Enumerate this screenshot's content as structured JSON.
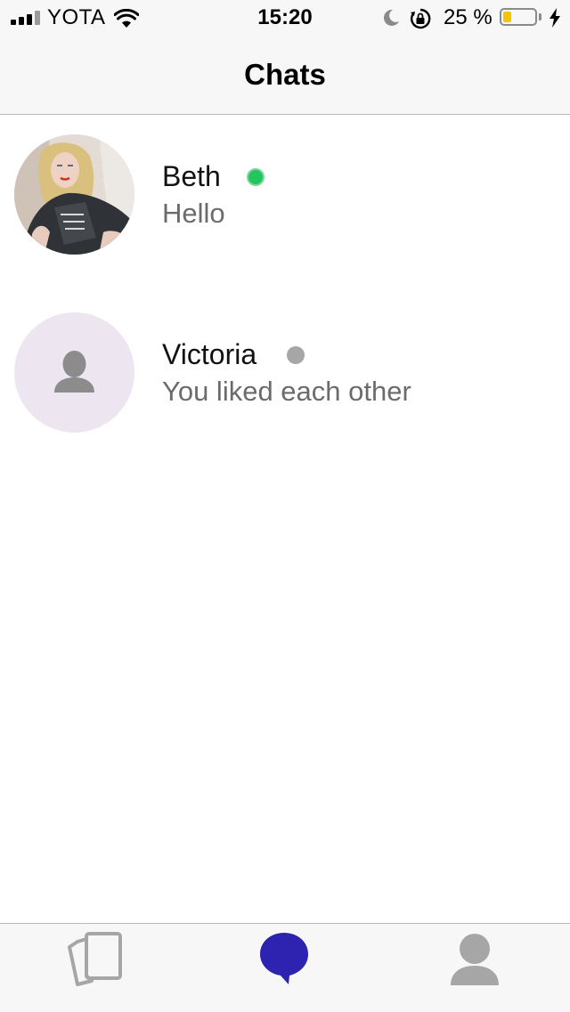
{
  "status_bar": {
    "carrier": "YOTA",
    "time": "15:20",
    "battery_percent_label": "25 %",
    "battery_level": 0.25,
    "icons": [
      "signal-icon",
      "wifi-icon",
      "moon-icon",
      "orientation-lock-icon",
      "battery-icon",
      "charging-bolt-icon"
    ]
  },
  "nav": {
    "title": "Chats"
  },
  "chats": [
    {
      "name": "Beth",
      "preview": "Hello",
      "status": "online",
      "status_color": "#22c55e",
      "avatar": "photo"
    },
    {
      "name": "Victoria",
      "preview": "You liked each other",
      "status": "offline",
      "status_color": "#a6a6a6",
      "avatar": "person-placeholder-icon"
    }
  ],
  "tab_bar": {
    "tabs": [
      {
        "icon": "cards-icon",
        "active": false
      },
      {
        "icon": "chat-bubble-icon",
        "active": true
      },
      {
        "icon": "profile-icon",
        "active": false
      }
    ],
    "active_color": "#2e22b0",
    "inactive_color": "#a6a6a6"
  },
  "colors": {
    "background": "#ffffff",
    "bar_background": "#f7f7f7",
    "secondary_text": "#6b6b6b"
  }
}
